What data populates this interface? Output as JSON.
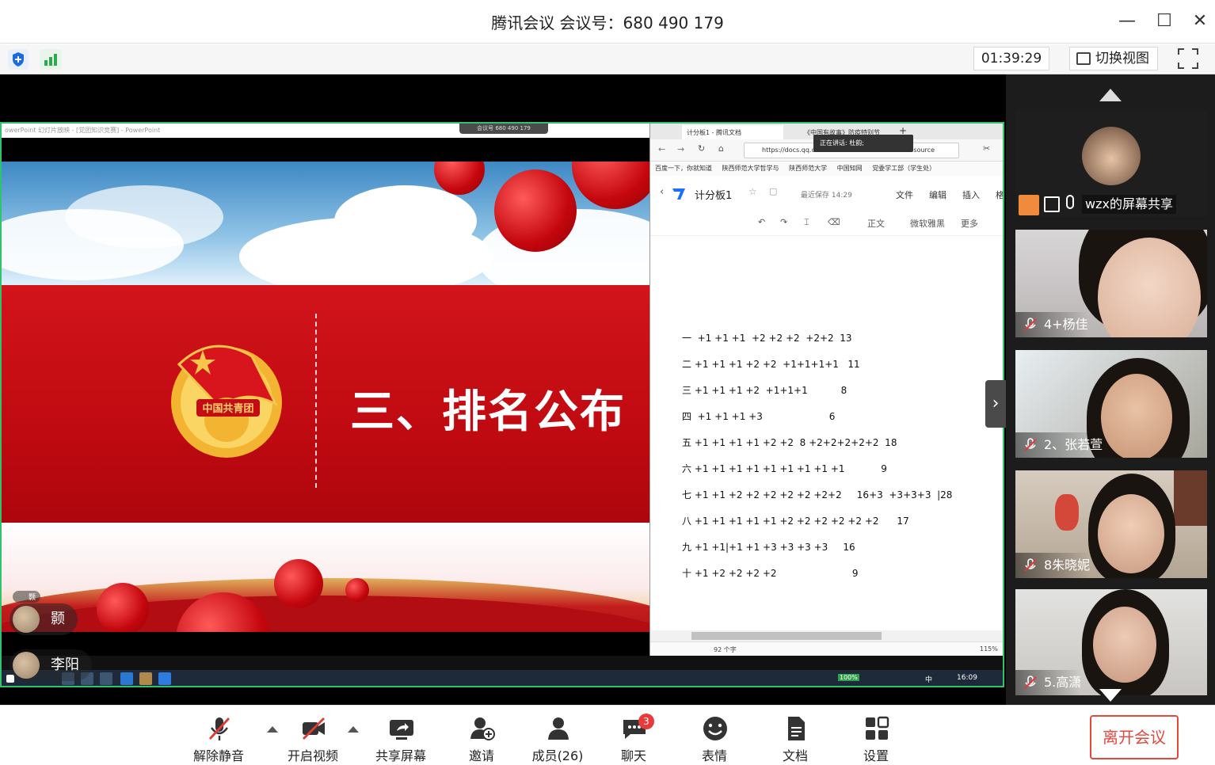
{
  "window": {
    "title": "腾讯会议 会议号：680 490 179"
  },
  "toolbar": {
    "timer": "01:39:29",
    "switch_view": "切换视图"
  },
  "share": {
    "meeting_label": "会议号 680 490 179",
    "ppt_caption": "owerPoint 幻灯片放映 - [党团知识竞赛] - PowerPoint",
    "slide_title": "三、排名公布",
    "emblem_text": "中国共青团",
    "doc": {
      "tabs": [
        "计分板1 - 腾讯文档",
        "《中国有故事》防疫特别节"
      ],
      "url": "https://docs.qq.co",
      "url_tail": "source",
      "speaking": "正在讲话: 杜韵;",
      "bookmarks": [
        "百度一下，你就知道",
        "陕西师范大学哲学与",
        "陕西师范大学",
        "中国知网",
        "党委学工部（学生处）"
      ],
      "title": "计分板1",
      "saved": "最近保存 14:29",
      "menus": [
        "文件",
        "编辑",
        "插入",
        "格"
      ],
      "tools": [
        "正文",
        "微软雅黑",
        "更多"
      ],
      "rows": [
        "一  +1 +1 +1  +2 +2 +2  +2+2  13",
        "二 +1 +1 +1 +2 +2  +1+1+1+1   11",
        "三 +1 +1 +1 +2  +1+1+1           8",
        "四  +1 +1 +1 +3                      6",
        "五 +1 +1 +1 +1 +2 +2  8 +2+2+2+2+2  18",
        "六 +1 +1 +1 +1 +1 +1 +1 +1 +1            9",
        "七 +1 +1 +2 +2 +2 +2 +2 +2+2     16+3  +3+3+3  |28",
        "八 +1 +1 +1 +1 +1 +2 +2 +2 +2 +2 +2      17",
        "九 +1 +1|+1 +1 +3 +3 +3 +3     16",
        "十 +1 +2 +2 +2 +2                         9"
      ],
      "word_count": "92 个字",
      "zoom": "115%"
    },
    "taskbar": {
      "clock": "16:09",
      "battery": "100%",
      "ime": "中"
    },
    "nametags": [
      "颢",
      "李阳"
    ],
    "nametag_small": "颢"
  },
  "participants": [
    {
      "name": "wzx的屏幕共享"
    },
    {
      "name": "4+杨佳"
    },
    {
      "name": "2、张若萱"
    },
    {
      "name": "8朱晓妮"
    },
    {
      "name": "5.高潇"
    }
  ],
  "bottom": {
    "unmute": "解除静音",
    "video": "开启视频",
    "share": "共享屏幕",
    "invite": "邀请",
    "members": "成员(26)",
    "chat": "聊天",
    "chat_badge": "3",
    "emoji": "表情",
    "docs": "文档",
    "settings": "设置",
    "leave": "离开会议"
  },
  "colors": {
    "accent_green": "#2fc36b",
    "leave_red": "#e5483c",
    "slide_red": "#c00a11"
  }
}
